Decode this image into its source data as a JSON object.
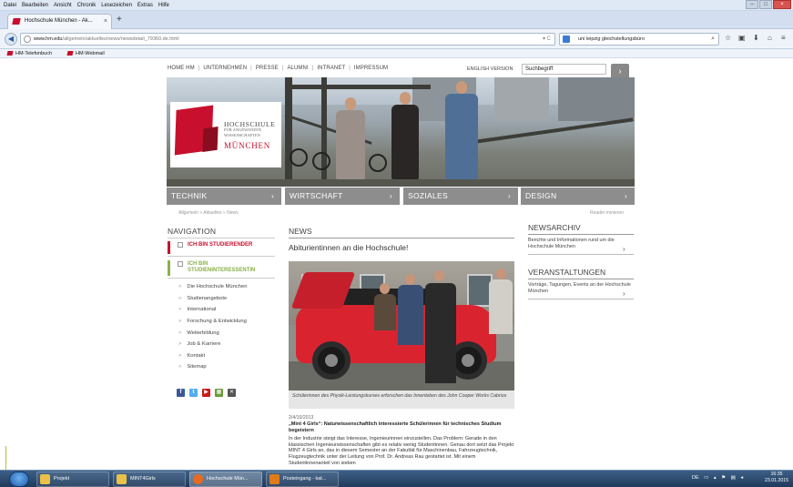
{
  "browser": {
    "menu": [
      "Datei",
      "Bearbeiten",
      "Ansicht",
      "Chronik",
      "Lesezeichen",
      "Extras",
      "Hilfe"
    ],
    "tab_title": "Hochschule München - Ak...",
    "tab_close": "×",
    "new_tab": "+",
    "url_host": "www.hm.edu",
    "url_path": "/allgemein/aktuelles/news/newsdetail_79360.de.html",
    "search_text": "uni leipzig gleichstellungsbüro",
    "bookmarks": [
      "HM-Telefonbuch",
      "HM-Webmail"
    ]
  },
  "site": {
    "topnav": [
      "HOME HM",
      "UNTERNEHMEN",
      "PRESSE",
      "ALUMNI",
      "INTRANET",
      "IMPRESSUM"
    ],
    "english": "ENGLISH VERSION",
    "search_value": "Suchbegriff",
    "search_go": "›",
    "logo": {
      "line1": "HOCHSCHULE",
      "line2": "FÜR ANGEWANDTE WISSENSCHAFTEN",
      "line3": "MÜNCHEN"
    },
    "categories": [
      "TECHNIK",
      "WIRTSCHAFT",
      "SOZIALES",
      "DESIGN"
    ],
    "breadcrumb": "Allgemein » Aktuelles » News",
    "reader": "Reader minieren"
  },
  "nav": {
    "heading": "NAVIGATION",
    "hl1": "ICH BIN STUDIERENDER",
    "hl2": "ICH BIN STUDIENINTERESSENTIN",
    "items": [
      "Die Hochschule München",
      "Studienangebote",
      "International",
      "Forschung & Entwicklung",
      "Weiterbildung",
      "Job & Karriere",
      "Kontakt",
      "Sitemap"
    ]
  },
  "news": {
    "heading": "NEWS",
    "headline": "Abiturientinnen an die Hochschule!",
    "caption": "Schülerinnen des Physik-Leistungskurses erforschen das Innenleben des John Cooper Works Cabrios",
    "date": "2/4/10/2013",
    "title": "„Mint 4 Girls“: Naturwissenschaftlich interessierte Schülerinnen für technisches Studium begeistern",
    "body": "In der Industrie steigt das Interesse, Ingenieurinnen einzustellen. Das Problem: Gerade in den klassischen Ingenieurwissenschaften gibt es relativ wenig Studentinnen. Genau dort setzt das Projekt MINT 4 Girls an, das in diesem Semester an der Fakultät für Maschinenbau, Fahrzeugtechnik, Flugzeugtechnik unter der Leitung von Prof. Dr. Andreas Rau gestartet ist. Mit einem Studentinnenanteil von sieben"
  },
  "right": {
    "archiv_head": "NEWSARCHIV",
    "archiv_text": "Berichte und Informationen rund um die Hochschule München",
    "events_head": "VERANSTALTUNGEN",
    "events_text": "Vorträge, Tagungen, Events an der Hochschule München"
  },
  "taskbar": {
    "items": [
      "Projekt",
      "MINT4Girls",
      "Hochschule Mün...",
      "Posteingang - kat..."
    ],
    "tray": "DE",
    "time": "16:35",
    "date": "23.01.2015"
  }
}
